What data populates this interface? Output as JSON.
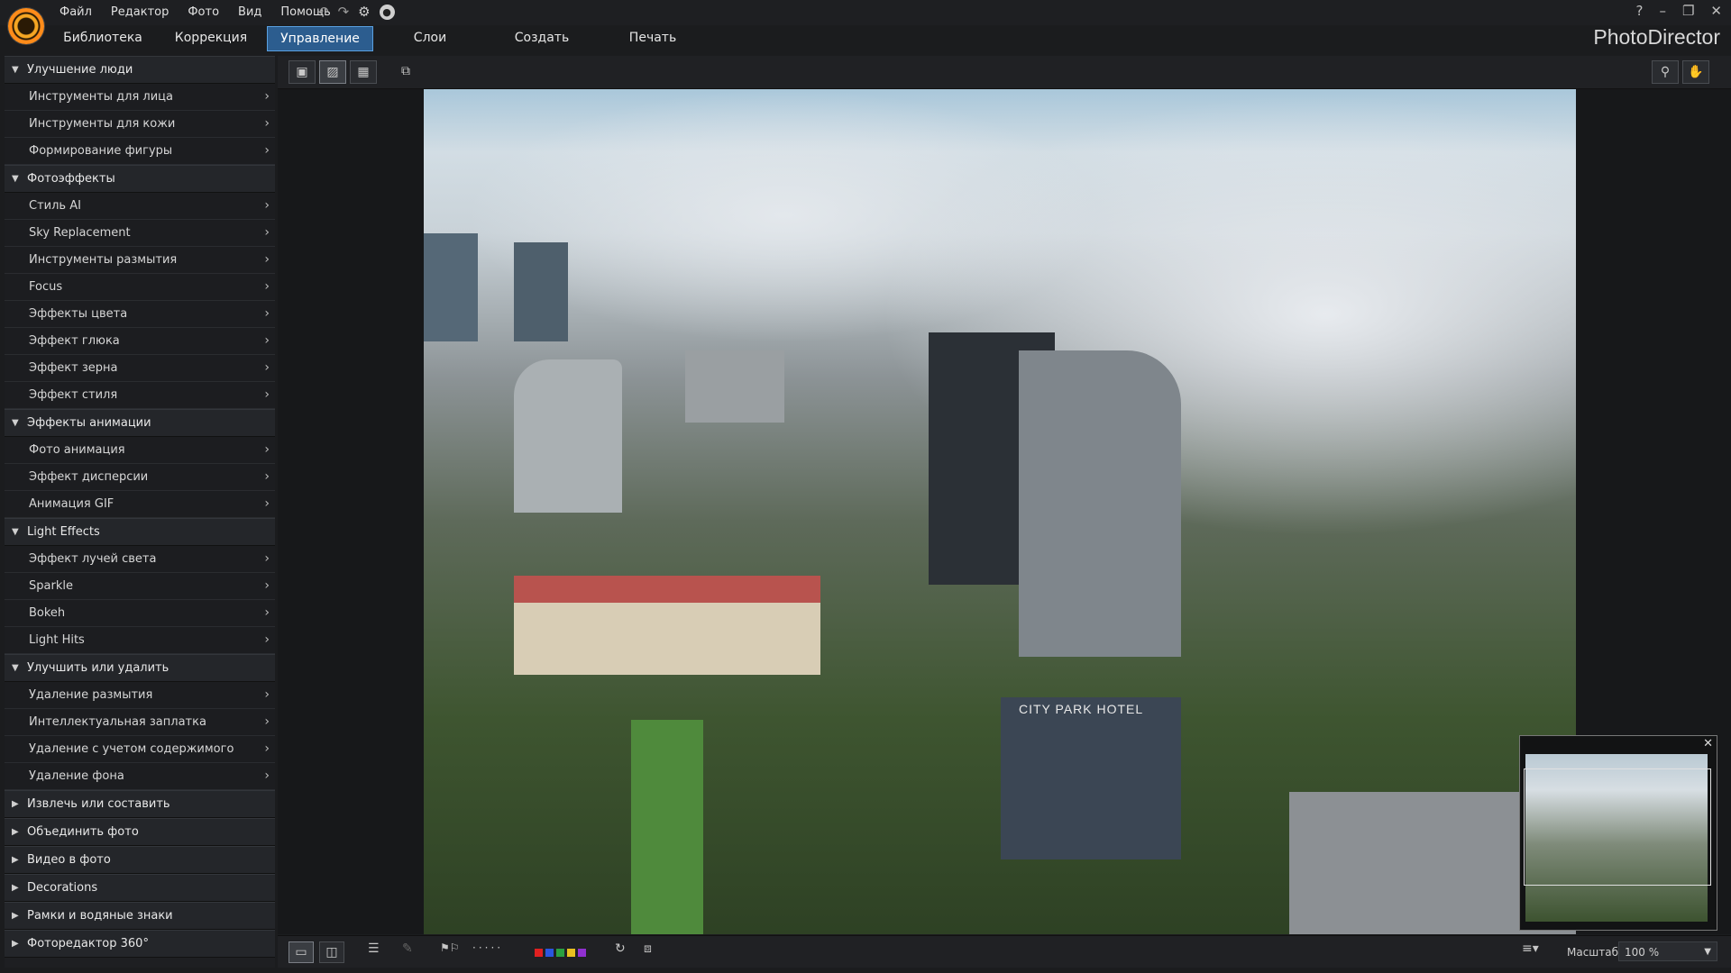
{
  "app": {
    "brand": "PhotoDirector"
  },
  "menu": [
    "Файл",
    "Редактор",
    "Фото",
    "Вид",
    "Помощь"
  ],
  "window_controls": {
    "help": "?",
    "minimize": "–",
    "restore": "❐",
    "close": "✕"
  },
  "tabs": [
    {
      "label": "Библиотека",
      "active": false
    },
    {
      "label": "Коррекция",
      "active": false
    },
    {
      "label": "Управление",
      "active": true
    },
    {
      "label": "Слои",
      "active": false
    },
    {
      "label": "Создать",
      "active": false
    },
    {
      "label": "Печать",
      "active": false
    }
  ],
  "sidebar": {
    "groups": [
      {
        "label": "Улучшение люди",
        "expanded": true,
        "items": [
          "Инструменты для лица",
          "Инструменты для кожи",
          "Формирование фигуры"
        ]
      },
      {
        "label": "Фотоэффекты",
        "expanded": true,
        "items": [
          "Стиль AI",
          "Sky Replacement",
          "Инструменты размытия",
          "Focus",
          "Эффекты цвета",
          "Эффект глюка",
          "Эффект зерна",
          "Эффект стиля"
        ]
      },
      {
        "label": "Эффекты анимации",
        "expanded": true,
        "items": [
          "Фото анимация",
          "Эффект дисперсии",
          "Анимация GIF"
        ]
      },
      {
        "label": "Light Effects",
        "expanded": true,
        "items": [
          "Эффект лучей света",
          "Sparkle",
          "Bokeh",
          "Light Hits"
        ]
      },
      {
        "label": "Улучшить или удалить",
        "expanded": true,
        "items": [
          "Удаление размытия",
          "Интеллектуальная заплатка",
          "Удаление с учетом содержимого",
          "Удаление фона"
        ]
      },
      {
        "label": "Извлечь или составить",
        "expanded": false,
        "items": []
      },
      {
        "label": "Объединить фото",
        "expanded": false,
        "items": []
      },
      {
        "label": "Видео в фото",
        "expanded": false,
        "items": []
      },
      {
        "label": "Decorations",
        "expanded": false,
        "items": []
      },
      {
        "label": "Рамки и водяные знаки",
        "expanded": false,
        "items": []
      },
      {
        "label": "Фоторедактор 360°",
        "expanded": false,
        "items": []
      }
    ]
  },
  "photo": {
    "sign_text": "CITY PARK HOTEL"
  },
  "bottom": {
    "zoom_label": "Масштаб:",
    "zoom_value": "100 %",
    "color_labels": [
      "#e02020",
      "#2a56e0",
      "#2aa040",
      "#e8c020",
      "#9030d0"
    ]
  },
  "colors": {
    "accent": "#2c5d8f",
    "accent_border": "#5aa0e0",
    "bg": "#1b1c1e"
  }
}
